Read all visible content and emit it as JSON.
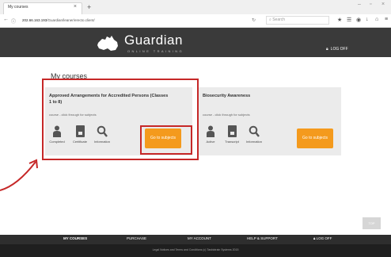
{
  "browser": {
    "tab_title": "My courses",
    "tab_close": "×",
    "new_tab": "+",
    "url_host": "202.66.163.193",
    "url_path": "/Guardian/leaner/erecto.client/",
    "search_placeholder": "Search",
    "window_controls": [
      "–",
      "▫",
      "×"
    ]
  },
  "header": {
    "brand": "Guardian",
    "tagline": "ONLINE TRAINING",
    "logoff": "LOG OFF"
  },
  "main": {
    "title": "My courses",
    "courses": [
      {
        "title_line1": "Approved Arrangements for Accredited Persons (Classes",
        "title_line2": "1 to 8)",
        "subtitle": "course - click through for subjects",
        "actions": [
          "Completed",
          "Certificate",
          "Information"
        ],
        "button": "Go to subjects"
      },
      {
        "title_line1": "Biosecurity Awareness",
        "title_line2": "",
        "subtitle": "course - click through for subjects",
        "actions": [
          "Active",
          "Transcript",
          "Information"
        ],
        "button": "Go to subjects"
      }
    ]
  },
  "scroll_top": "TOP",
  "footer": {
    "nav": [
      "MY COURSES",
      "PURCHASE",
      "MY ACCOUNT",
      "HELP & SUPPORT",
      "LOG OFF"
    ],
    "legal": "Legal Notices and Terms and Conditions   (c) Tasbiotrain Systems 2015"
  },
  "colors": {
    "header_bg": "#3a3a3a",
    "card_bg": "#ebebeb",
    "button_orange": "#f49a1d",
    "annotation_red": "#c62828",
    "footer_bg": "#2e2e2e"
  }
}
